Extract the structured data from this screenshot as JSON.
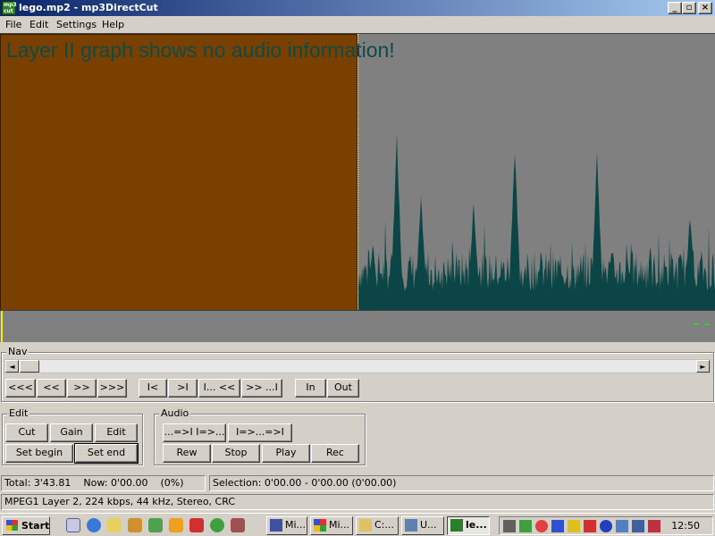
{
  "window": {
    "title": "lego.mp2 - mp3DirectCut",
    "app_icon_text": "mp3 cut",
    "minimize": "_",
    "maximize": "▫",
    "close": "×"
  },
  "menu": {
    "file": "File",
    "edit": "Edit",
    "settings": "Settings",
    "help": "Help"
  },
  "graph": {
    "message": "Layer II graph shows no audio information!",
    "colors": {
      "background": "#808080",
      "selection": "#7a4000",
      "waveform": "#0b4545",
      "cursor": "#ffffa0"
    }
  },
  "nav": {
    "label": "Nav",
    "scroll_left": "◄",
    "scroll_right": "►",
    "buttons": {
      "rewind_fast": "<<<",
      "rewind": "<<",
      "forward": ">>",
      "forward_fast": ">>>",
      "to_start": "I<",
      "to_end": ">I",
      "sel_begin_back": "I... <<",
      "sel_end_fwd": ">> ...I",
      "in": "In",
      "out": "Out"
    }
  },
  "edit": {
    "label": "Edit",
    "cut": "Cut",
    "gain": "Gain",
    "edit": "Edit",
    "set_begin": "Set begin",
    "set_end": "Set end"
  },
  "audio": {
    "label": "Audio",
    "play_to_sel": "...=>I  I=>...",
    "play_sel": "I=>...=>I",
    "rew": "Rew",
    "stop": "Stop",
    "play": "Play",
    "rec": "Rec"
  },
  "status": {
    "total": "Total: 3'43.81",
    "now": "Now: 0'00.00",
    "percent": "(0%)",
    "selection": "Selection: 0'00.00 - 0'00.00 (0'00.00)",
    "format": "MPEG1 Layer 2, 224 kbps, 44 kHz, Stereo, CRC"
  },
  "taskbar": {
    "start": "Start",
    "tasks": [
      "Mi...",
      "Mi...",
      "C:...",
      "U...",
      "le..."
    ],
    "clock": "12:50"
  }
}
